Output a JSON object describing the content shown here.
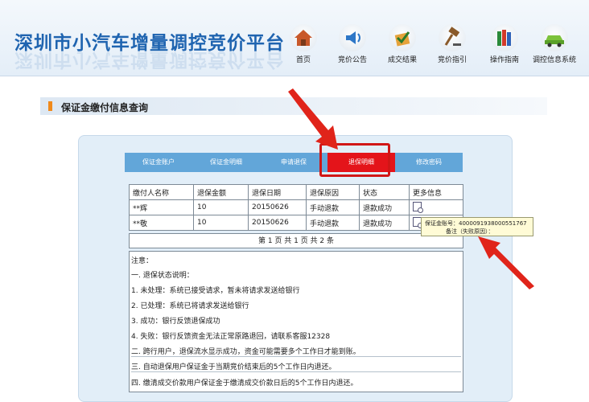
{
  "site": {
    "title": "深圳市小汽车增量调控竞价平台"
  },
  "nav": [
    {
      "label": "首页",
      "icon": "home-icon"
    },
    {
      "label": "竞价公告",
      "icon": "announcement-icon"
    },
    {
      "label": "成交结果",
      "icon": "result-icon"
    },
    {
      "label": "竞价指引",
      "icon": "gavel-icon"
    },
    {
      "label": "操作指南",
      "icon": "books-icon"
    },
    {
      "label": "调控信息系统",
      "icon": "car-icon"
    }
  ],
  "section": {
    "title": "保证金缴付信息查询"
  },
  "tabs": [
    {
      "label": "保证金账户",
      "active": false
    },
    {
      "label": "保证金明细",
      "active": false
    },
    {
      "label": "申请退保",
      "active": false
    },
    {
      "label": "退保明细",
      "active": true
    },
    {
      "label": "修改密码",
      "active": false
    }
  ],
  "table": {
    "headers": [
      "缴付人名称",
      "退保金额",
      "退保日期",
      "退保原因",
      "状态",
      "更多信息"
    ],
    "rows": [
      [
        "**辉",
        "10",
        "20150626",
        "手动退款",
        "退款成功"
      ],
      [
        "**敬",
        "10",
        "20150626",
        "手动退款",
        "退款成功"
      ]
    ]
  },
  "pager": {
    "text": "第 1 页 共 1 页 共 2 条"
  },
  "notes": {
    "title": "注意：",
    "lines": [
      "一. 退保状态说明：",
      "1. 未处理：系统已接受请求，暂未将请求发送给银行",
      "2. 已处理：系统已将请求发送给银行",
      "3. 成功：银行反馈退保成功",
      "4. 失败：银行反馈资金无法正常原路退回，请联系客服12328",
      "二. 跨行用户，退保流水显示成功，资金可能需要多个工作日才能到账。",
      "三. 自动退保用户保证金于当期竞价结束后的5个工作日内退还。",
      "四. 缴清成交价款用户保证金于缴清成交价款日后的5个工作日内退还。"
    ]
  },
  "tooltip": {
    "line1": "保证金账号：4000091938000551767",
    "line2": "备注（失败原因）："
  },
  "colors": {
    "title_blue": "#1f64b0",
    "tab_blue": "#62a6d9",
    "tab_active_red": "#e4141a",
    "annotation_red": "#d11616",
    "section_orange": "#f08a1c"
  }
}
